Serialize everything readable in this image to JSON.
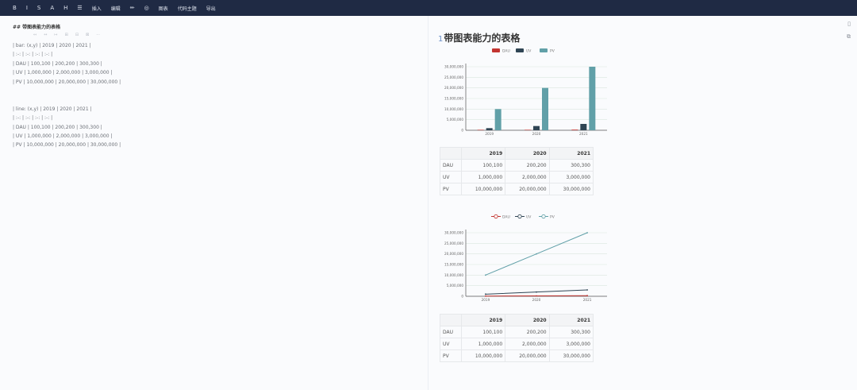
{
  "toolbar": {
    "items": [
      {
        "label": "B",
        "icon": "bold-icon"
      },
      {
        "label": "I",
        "icon": "italic-icon"
      },
      {
        "label": "S",
        "icon": "strikethrough-icon"
      },
      {
        "label": "A",
        "icon": "underline-icon"
      },
      {
        "label": "H",
        "icon": "heading-icon"
      },
      {
        "label": "☰",
        "icon": "list-icon"
      },
      {
        "label": "插入",
        "icon": null
      },
      {
        "label": "编辑",
        "icon": null
      },
      {
        "label": "✏",
        "icon": "pen-icon"
      },
      {
        "label": "◎",
        "icon": "target-icon"
      },
      {
        "label": "图表",
        "icon": null
      },
      {
        "label": "代码主题",
        "icon": null
      },
      {
        "label": "导出",
        "icon": null
      }
    ]
  },
  "editor": {
    "heading": "## 带图表能力的表格",
    "lines": [
      "| bar: (x,y) | 2019 | 2020 | 2021 |",
      "| :-: | :-: | :-: | :-: |",
      "| DAU | 100,100 | 200,200 | 300,300 |",
      "| UV | 1,000,000 | 2,000,000 | 3,000,000 |",
      "| PV | 10,000,000 | 20,000,000 | 30,000,000 |",
      "",
      "",
      "| line: (x,y) | 2019 | 2020 | 2021 |",
      "| :-: | :-: | :-: | :-: |",
      "| DAU | 100,100 | 200,200 | 300,300 |",
      "| UV | 1,000,000 | 2,000,000 | 3,000,000 |",
      "| PV | 10,000,000 | 20,000,000 | 30,000,000 |"
    ]
  },
  "preview": {
    "heading_num": "1",
    "heading": "带图表能力的表格",
    "table_headers": [
      "",
      "2019",
      "2020",
      "2021"
    ],
    "table_rows": [
      [
        "DAU",
        "100,100",
        "200,200",
        "300,300"
      ],
      [
        "UV",
        "1,000,000",
        "2,000,000",
        "3,000,000"
      ],
      [
        "PV",
        "10,000,000",
        "20,000,000",
        "30,000,000"
      ]
    ]
  },
  "chart_data": [
    {
      "type": "bar",
      "categories": [
        "2019",
        "2020",
        "2021"
      ],
      "series": [
        {
          "name": "DAU",
          "values": [
            100100,
            200200,
            300300
          ],
          "color": "#c23531"
        },
        {
          "name": "UV",
          "values": [
            1000000,
            2000000,
            3000000
          ],
          "color": "#2f4554"
        },
        {
          "name": "PV",
          "values": [
            10000000,
            20000000,
            30000000
          ],
          "color": "#61a0a8"
        }
      ],
      "ylim": [
        0,
        30000000
      ],
      "yticks": [
        "0",
        "5,000,000",
        "10,000,000",
        "15,000,000",
        "20,000,000",
        "25,000,000",
        "30,000,000"
      ],
      "legend": "top-center",
      "grid": true
    },
    {
      "type": "line",
      "categories": [
        "2019",
        "2020",
        "2021"
      ],
      "series": [
        {
          "name": "DAU",
          "values": [
            100100,
            200200,
            300300
          ],
          "color": "#c23531"
        },
        {
          "name": "UV",
          "values": [
            1000000,
            2000000,
            3000000
          ],
          "color": "#2f4554"
        },
        {
          "name": "PV",
          "values": [
            10000000,
            20000000,
            30000000
          ],
          "color": "#61a0a8"
        }
      ],
      "ylim": [
        0,
        30000000
      ],
      "yticks": [
        "0",
        "5,000,000",
        "10,000,000",
        "15,000,000",
        "20,000,000",
        "25,000,000",
        "30,000,000"
      ],
      "legend": "top-center",
      "grid": true
    }
  ]
}
